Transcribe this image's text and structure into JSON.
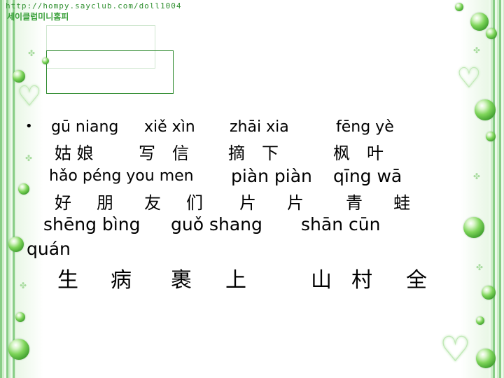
{
  "header": {
    "url_text": "http://hompy.sayclub.com/doll1004",
    "korean_text": "세이클럽미니홈피"
  },
  "lines": {
    "l1_py_a": "gū niang",
    "l1_py_b": "xiě xìn",
    "l1_py_c": "zhāi xia",
    "l1_py_d": "fēng yè",
    "l2_hz_a": "姑 娘",
    "l2_hz_b": "写　信",
    "l2_hz_c": "摘　下",
    "l2_hz_d": "枫　叶",
    "l3_py_a": "hǎo péng you men",
    "l3_py_b": "piàn piàn",
    "l3_py_c": "qīng wā",
    "l4_hz_a": "好",
    "l4_hz_b": "朋",
    "l4_hz_c": "友",
    "l4_hz_d": "们",
    "l4_hz_e": "片",
    "l4_hz_f": "片",
    "l4_hz_g": "青",
    "l4_hz_h": "蛙",
    "l5_py_a": "shēng bìng",
    "l5_py_b": "guǒ shang",
    "l5_py_c": "shān cūn",
    "l6_py_a": "quán",
    "l7_hz_a": "生",
    "l7_hz_b": "病",
    "l7_hz_c": "裹",
    "l7_hz_d": "上",
    "l7_hz_e": "山",
    "l7_hz_f": "村",
    "l7_hz_g": "全"
  },
  "colors": {
    "accent": "#3a9a2a",
    "stripe": "#7cc87a"
  }
}
